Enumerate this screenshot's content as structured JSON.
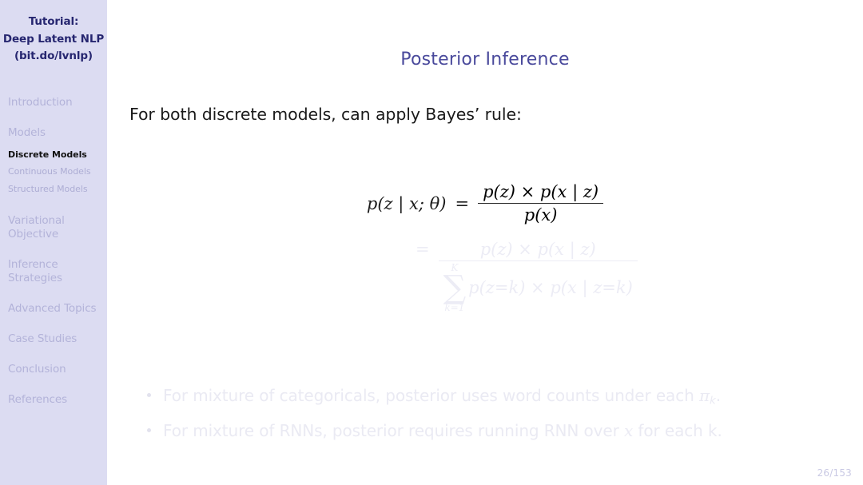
{
  "sidebar": {
    "header_lines": [
      "Tutorial:",
      "Deep Latent NLP",
      "(bit.do/lvnlp)"
    ],
    "sections": [
      {
        "name": "introduction",
        "lines": [
          "Introduction"
        ]
      },
      {
        "name": "models",
        "lines": [
          "Models"
        ]
      },
      {
        "name": "variational-objective",
        "lines": [
          "Variational",
          "Objective"
        ]
      },
      {
        "name": "inference-strategies",
        "lines": [
          "Inference",
          "Strategies"
        ]
      },
      {
        "name": "advanced-topics",
        "lines": [
          "Advanced Topics"
        ]
      },
      {
        "name": "case-studies",
        "lines": [
          "Case Studies"
        ]
      },
      {
        "name": "conclusion",
        "lines": [
          "Conclusion"
        ]
      },
      {
        "name": "references",
        "lines": [
          "References"
        ]
      }
    ],
    "subsections": [
      {
        "name": "discrete-models",
        "label": "Discrete Models",
        "active": true
      },
      {
        "name": "continuous-models",
        "label": "Continuous Models",
        "active": false
      },
      {
        "name": "structured-models",
        "label": "Structured Models",
        "active": false
      }
    ],
    "colors": {
      "background": "#dcdcf2",
      "header_text": "#262670",
      "section_text": "#b3b3d9",
      "active_text": "#111111"
    }
  },
  "page_number": "26/153",
  "main": {
    "title": "Posterior Inference",
    "title_color": "#4a4a9c",
    "lead_text": "For both discrete models, can apply Bayes’ rule:",
    "equation_1": {
      "lhs": "p(z | x; θ)",
      "relation": "=",
      "numerator": "p(z) × p(x | z)",
      "denominator": "p(x)"
    },
    "equation_2": {
      "relation": "=",
      "numerator": "p(z) × p(x | z)",
      "sum_upper": "K",
      "sum_symbol": "∑",
      "sum_lower": "k=1",
      "denominator_tail": "p(z=k) × p(x | z=k)",
      "revealed": false
    },
    "bullets": [
      {
        "name": "bullet-mixture-categoricals",
        "text_before": "For mixture of categoricals, posterior uses word counts under each ",
        "symbol": "π",
        "symbol_sub": "k",
        "text_after": ".",
        "revealed": false
      },
      {
        "name": "bullet-mixture-rnns",
        "text_before": "For mixture of RNNs, posterior requires running RNN over ",
        "symbol": "x",
        "symbol_sub": "",
        "text_after": " for each k.",
        "revealed": false
      }
    ]
  }
}
